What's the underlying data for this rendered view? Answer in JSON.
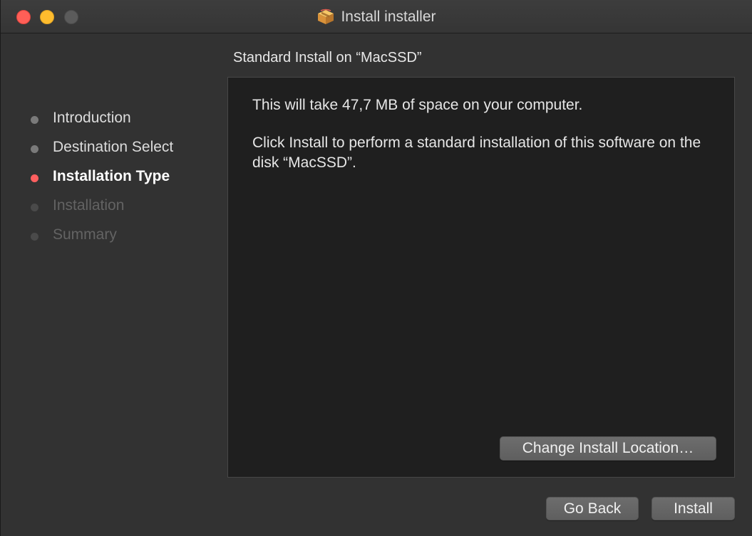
{
  "window": {
    "title": "Install installer",
    "title_icon": "package-icon"
  },
  "heading": "Standard Install on “MacSSD”",
  "sidebar": {
    "steps": [
      {
        "label": "Introduction",
        "state": "done"
      },
      {
        "label": "Destination Select",
        "state": "done"
      },
      {
        "label": "Installation Type",
        "state": "current"
      },
      {
        "label": "Installation",
        "state": "pending"
      },
      {
        "label": "Summary",
        "state": "pending"
      }
    ]
  },
  "content": {
    "space_text": "This will take 47,7 MB of space on your computer.",
    "instruction_text": "Click Install to perform a standard installation of this software on the disk “MacSSD”.",
    "change_location_label": "Change Install Location…"
  },
  "footer": {
    "go_back_label": "Go Back",
    "install_label": "Install"
  },
  "colors": {
    "current_step_dot": "#ff5f5f",
    "close": "#ff5f57",
    "minimize": "#febc2e",
    "zoom_inactive": "#5b5b5b"
  }
}
